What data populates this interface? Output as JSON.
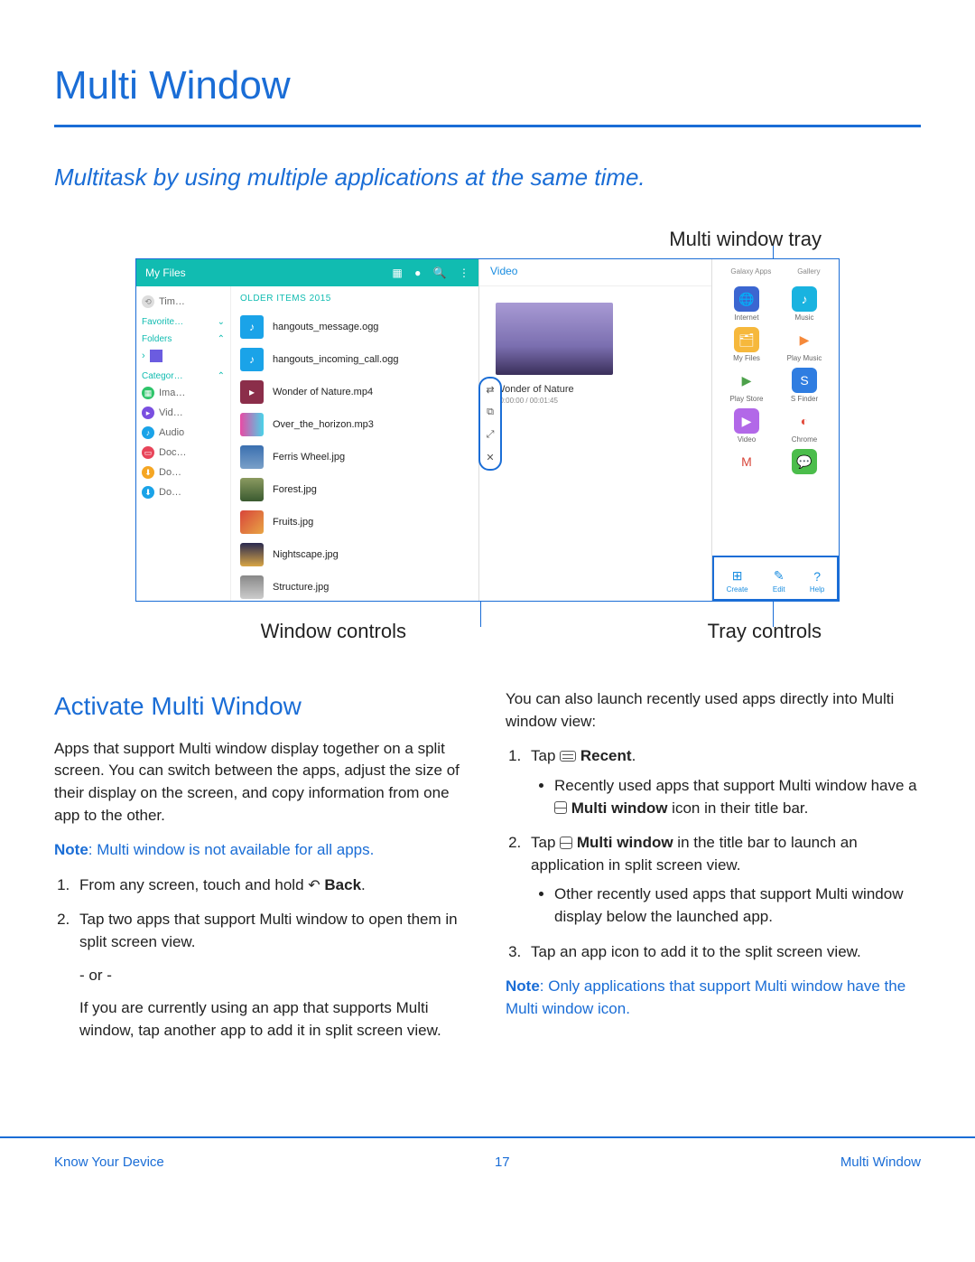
{
  "title": "Multi Window",
  "subtitle": "Multitask by using multiple applications at the same time.",
  "callouts": {
    "top": "Multi window tray",
    "bottom_left": "Window controls",
    "bottom_right": "Tray controls"
  },
  "screenshot": {
    "files": {
      "header_title": "My Files",
      "sidebar": {
        "timeline": "Tim…",
        "favorites": "Favorite…",
        "folders": "Folders",
        "categories": "Categor…",
        "cat_items": [
          "Ima…",
          "Vid…",
          "Audio",
          "Doc…",
          "Do…",
          "Do…"
        ]
      },
      "older_label": "OLDER ITEMS    2015",
      "list": [
        "hangouts_message.ogg",
        "hangouts_incoming_call.ogg",
        "Wonder of Nature.mp4",
        "Over_the_horizon.mp3",
        "Ferris Wheel.jpg",
        "Forest.jpg",
        "Fruits.jpg",
        "Nightscape.jpg",
        "Structure.jpg"
      ]
    },
    "video": {
      "header": "Video",
      "title": "Wonder of Nature",
      "time": "00:00:00 / 00:01:45"
    },
    "tray": {
      "header_labels": [
        "Galaxy Apps",
        "Gallery"
      ],
      "apps": [
        {
          "label": "Internet",
          "color": "#3b66d1",
          "glyph": "🌐"
        },
        {
          "label": "Music",
          "color": "#19b3e0",
          "glyph": "♪"
        },
        {
          "label": "My Files",
          "color": "#f6b83c",
          "glyph": "🗂"
        },
        {
          "label": "Play Music",
          "color": "#fff",
          "glyph": "▶",
          "fg": "#f5893a"
        },
        {
          "label": "Play Store",
          "color": "#fff",
          "glyph": "▶",
          "fg": "#4da14b"
        },
        {
          "label": "S Finder",
          "color": "#2f7de1",
          "glyph": "S"
        },
        {
          "label": "Video",
          "color": "#b268e8",
          "glyph": "▶"
        },
        {
          "label": "Chrome",
          "color": "#fff",
          "glyph": "◐",
          "fg": "#e24a3a"
        },
        {
          "label": "",
          "color": "#fff",
          "glyph": "M",
          "fg": "#d8463a"
        },
        {
          "label": "",
          "color": "#4bbd4b",
          "glyph": "💬"
        }
      ],
      "controls": [
        {
          "label": "Create",
          "glyph": "⊞"
        },
        {
          "label": "Edit",
          "glyph": "✎"
        },
        {
          "label": "Help",
          "glyph": "?"
        }
      ]
    },
    "win_controls_glyphs": [
      "⇄",
      "⧉",
      "⤢",
      "✕"
    ]
  },
  "section_heading": "Activate Multi Window",
  "left_col": {
    "p1": "Apps that support Multi window display together on a split screen. You can switch between the apps, adjust the size of their display on the screen, and copy information from one app to the other.",
    "note": "Note: Multi window is not available for all apps.",
    "step1_pre": "From any screen, touch and hold ",
    "step1_bold": "Back",
    "step1_post": ".",
    "step2": "Tap two apps that support Multi window to open them in split screen view.",
    "or": "- or -",
    "step2b": "If you are currently using an app that supports Multi window, tap another app to add it in split screen view."
  },
  "right_col": {
    "intro": "You can also launch recently used apps directly into Multi window view:",
    "s1_pre": "Tap ",
    "s1_bold": "Recent",
    "s1_post": ".",
    "s1b_pre": "Recently used apps that support Multi window have a ",
    "s1b_bold": "Multi window",
    "s1b_post": " icon in their title bar.",
    "s2_pre": "Tap ",
    "s2_bold": "Multi window",
    "s2_post": " in the title bar to launch an application in split screen view.",
    "s2b": "Other recently used apps that support Multi window display below the launched app.",
    "s3": "Tap an app icon to add it to the split screen view.",
    "note": "Note: Only applications that support Multi window have the Multi window icon."
  },
  "footer": {
    "left": "Know Your Device",
    "center": "17",
    "right": "Multi Window"
  }
}
